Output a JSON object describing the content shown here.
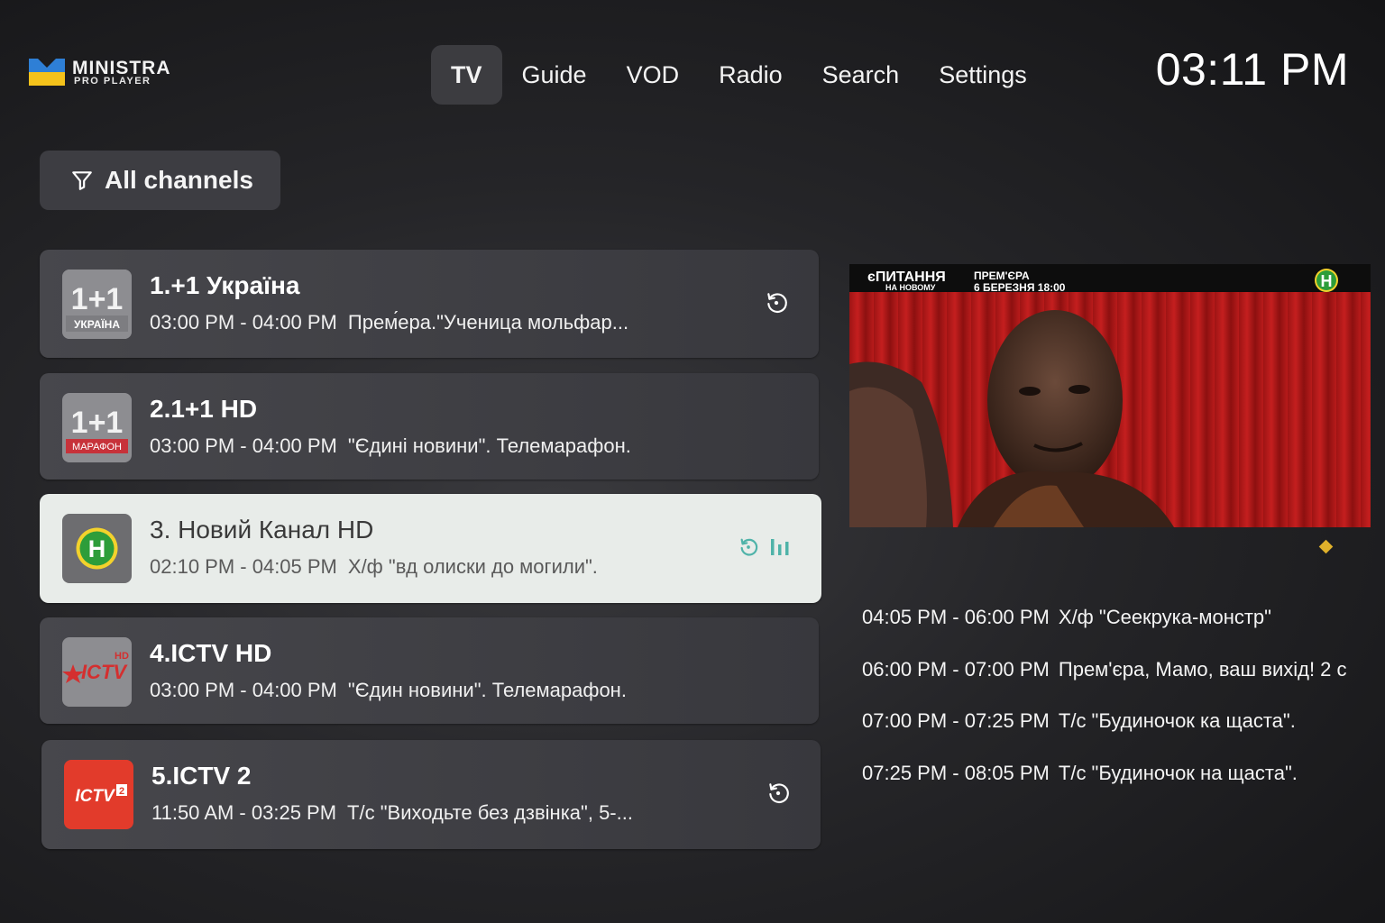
{
  "app": {
    "logo_title": "MINISTRA",
    "logo_subtitle": "PRO PLAYER"
  },
  "nav": {
    "items": [
      {
        "label": "TV",
        "active": true
      },
      {
        "label": "Guide",
        "active": false
      },
      {
        "label": "VOD",
        "active": false
      },
      {
        "label": "Radio",
        "active": false
      },
      {
        "label": "Search",
        "active": false
      },
      {
        "label": "Settings",
        "active": false
      }
    ]
  },
  "clock": "03:11 PM",
  "filter": {
    "icon": "filter-icon",
    "label": "All channels"
  },
  "channels": [
    {
      "name": "1.+1 Україна",
      "logo_text": "1+1",
      "logo_sub": "УКРАЇНА",
      "time": "03:00 PM - 04:00 PM",
      "program": "Прем́ера.\"Ученица мольфар...",
      "icon": "replay-icon"
    },
    {
      "name": "2.1+1 HD",
      "logo_text": "1+1",
      "logo_sub": "МАРАФОН",
      "time": "03:00 PM - 04:00 PM",
      "program": "\"Єдині новини\". Телемарафон.",
      "icon": ""
    },
    {
      "name": "3. Новий Канал HD",
      "logo_text": "H",
      "logo_sub": "",
      "time": "02:10 PM - 04:05 PM",
      "program": "Х/ф \"вд олиски до могили\".",
      "icon": "replay-icon",
      "selected": true
    },
    {
      "name": "4.ICTV HD",
      "logo_text": "ICTV",
      "logo_sub": "HD",
      "time": "03:00 PM - 04:00 PM",
      "program": "\"Єдин новини\". Телемарафон.",
      "icon": ""
    },
    {
      "name": "5.ICTV 2",
      "logo_text": "ICTV",
      "logo_sub": "2",
      "time": "11:50 AM - 03:25 PM",
      "program": "Т/с \"Виходьте без дзвінка\", 5-...",
      "icon": "replay-icon"
    }
  ],
  "preview": {
    "overlay_left": "єПИТАННЯ",
    "overlay_left_sub": "НА НОВОМУ",
    "overlay_right": "ПРЕМ'ЄРА",
    "overlay_right_sub": "6 БЕРЕЗНЯ 18:00",
    "channel_badge": "H"
  },
  "epg": [
    {
      "time": "04:05 PM - 06:00 PM",
      "title": "Х/ф \"Сеекрука-монстр\""
    },
    {
      "time": "06:00 PM - 07:00 PM",
      "title": "Прем'єра, Мамо, ваш вихід! 2 с"
    },
    {
      "time": "07:00 PM - 07:25 PM",
      "title": "Т/с \"Будиночок ка щаста\"."
    },
    {
      "time": "07:25 PM - 08:05 PM",
      "title": "Т/с \"Будиночок на щаста\"."
    }
  ],
  "colors": {
    "accent_teal": "#4fb3a9",
    "indicator_gold": "#e0b12b",
    "logo_blue": "#2e7fd6",
    "logo_yellow": "#f4c21b"
  }
}
